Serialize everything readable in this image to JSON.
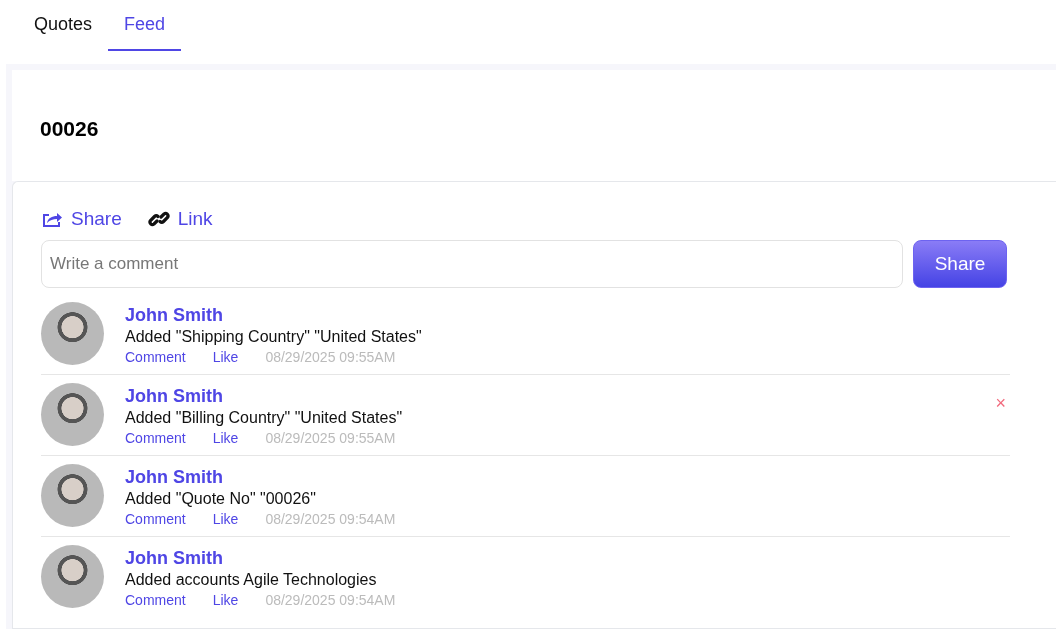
{
  "tabs": [
    {
      "label": "Quotes",
      "selected": false
    },
    {
      "label": "Feed",
      "selected": true
    }
  ],
  "record": {
    "title": "00026"
  },
  "actions": [
    {
      "kind": "share",
      "label": "Share"
    },
    {
      "kind": "link",
      "label": "Link"
    }
  ],
  "comment": {
    "placeholder": "Write a comment",
    "button": "Share"
  },
  "feed": [
    {
      "author": "John Smith",
      "text": "Added \"Shipping Country\" \"United States\"",
      "comment": "Comment",
      "like": "Like",
      "time": "08/29/2025 09:55AM"
    },
    {
      "author": "John Smith",
      "text": "Added \"Billing Country\" \"United States\"",
      "comment": "Comment",
      "like": "Like",
      "time": "08/29/2025 09:55AM",
      "delete": "×"
    },
    {
      "author": "John Smith",
      "text": "Added \"Quote No\" \"00026\"",
      "comment": "Comment",
      "like": "Like",
      "time": "08/29/2025 09:54AM"
    },
    {
      "author": "John Smith",
      "text": "Added accounts Agile Technologies",
      "comment": "Comment",
      "like": "Like",
      "time": "08/29/2025 09:54AM"
    }
  ]
}
